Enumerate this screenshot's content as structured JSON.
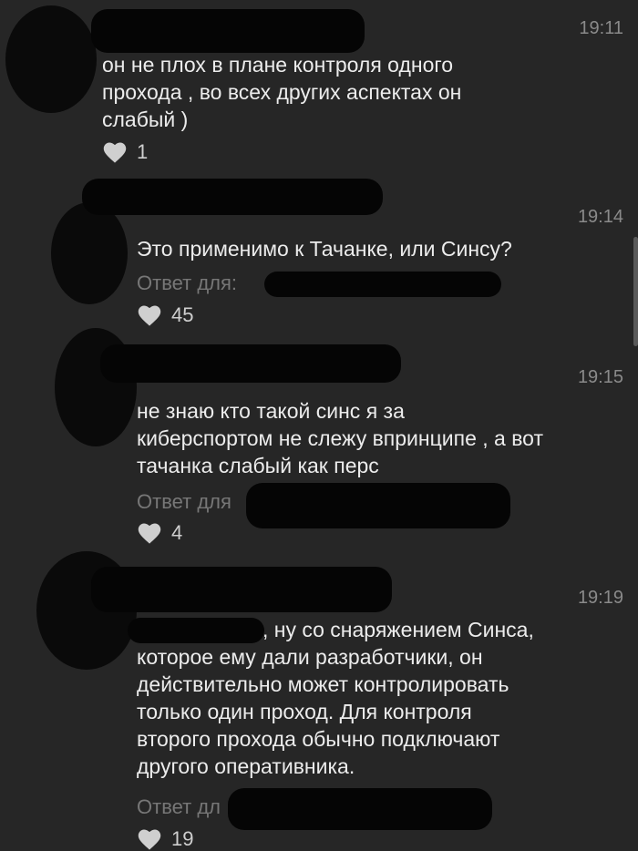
{
  "comments": [
    {
      "time": "19:11",
      "text": "он не плох в плане контроля одного\nпрохода , во всех других аспектах он\nслабый )",
      "likes": "1"
    },
    {
      "time": "19:14",
      "text": "Это применимо к Тачанке, или Синсу?",
      "reply": "Ответ для:",
      "likes": "45"
    },
    {
      "time": "19:15",
      "text": "не знаю кто такой синс я за\nкиберспортом не слежу впринципе , а вот\nтачанка слабый как перс",
      "reply": "Ответ для",
      "likes": "4"
    },
    {
      "time": "19:19",
      "text": ", ну со снаряжением Синса,\nкоторое ему дали разработчики, он\nдействительно может контролировать\nтолько один проход. Для контроля\nвторого прохода обычно подключают\nдругого оперативника.",
      "reply": "Ответ дл",
      "likes": "19"
    }
  ]
}
